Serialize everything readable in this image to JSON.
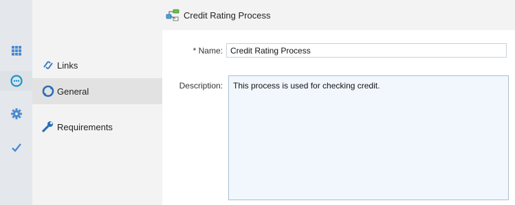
{
  "toolbar_icons": [
    {
      "icon": "grid-icon",
      "color": "#4a8ad0"
    },
    {
      "icon": "chat-bubble-icon",
      "color": "#1a93c9"
    },
    {
      "icon": "gear-icon",
      "color": "#4a8ad0"
    },
    {
      "icon": "checkmark-icon",
      "color": "#4a8ad0"
    }
  ],
  "nav": {
    "items": [
      {
        "label": "Links",
        "icon": "links-icon"
      },
      {
        "label": "General",
        "icon": "circle-arrows-icon",
        "selected": true
      },
      {
        "label": "Requirements",
        "icon": "wrench-icon"
      }
    ]
  },
  "header": {
    "title": "Credit Rating Process",
    "icon": "process-diagram-icon"
  },
  "form": {
    "name_label": "* Name:",
    "name_value": "Credit Rating Process",
    "description_label": "Description:",
    "description_value": "This process is used for checking credit."
  },
  "colors": {
    "accent": "#4a8ad0",
    "nav_bg": "#f3f3f3",
    "strip_bg": "#e4e7eb",
    "desc_bg": "#f1f7fd"
  }
}
